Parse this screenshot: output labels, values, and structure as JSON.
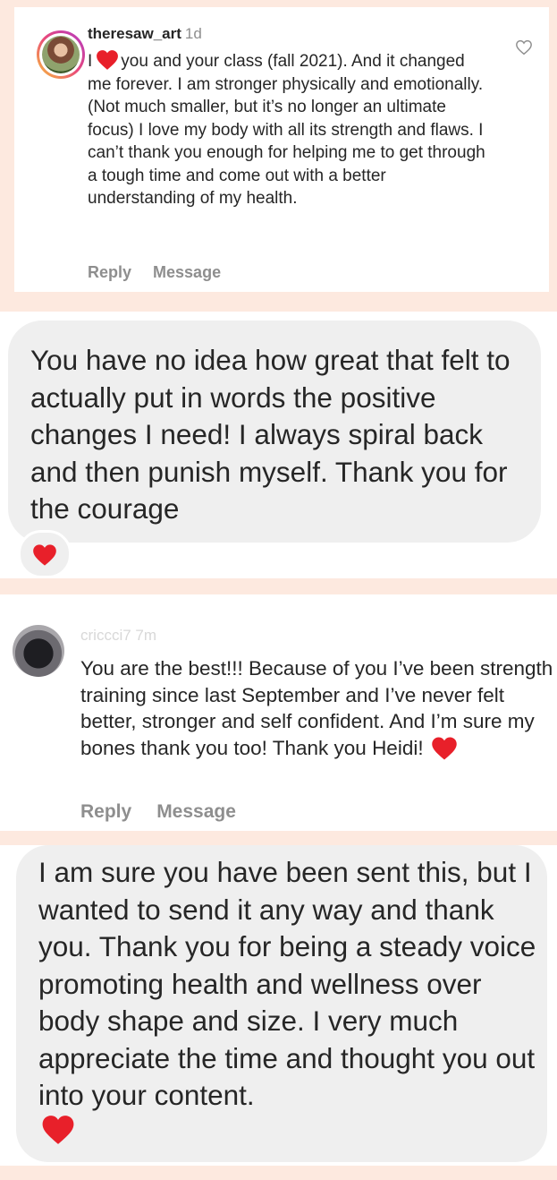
{
  "comment1": {
    "username": "theresaw_art",
    "time": "1d",
    "text_before_heart": "I",
    "text_after_heart": "you and your class (fall 2021). And it changed me forever. I am stronger physically and emotionally. (Not much smaller, but it’s no longer an ultimate focus) I love my body with all its strength and flaws. I can’t thank you enough for helping me to get through a tough time and come out with a better understanding of my health.",
    "reply_label": "Reply",
    "message_label": "Message",
    "like_icon": "heart-outline-icon"
  },
  "message1": {
    "text": "You have no idea how great that felt to actually put in words the positive changes I need! I always spiral back and then punish myself. Thank you for the courage",
    "reaction_icon": "red-heart-icon"
  },
  "comment2": {
    "username": "criccci7 7m",
    "text": "You are the best!!! Because of you I’ve been strength training since last September and I’ve never felt better, stronger and self confident.  And I’m sure my bones thank you too!  Thank you Heidi!",
    "reply_label": "Reply",
    "message_label": "Message"
  },
  "message2": {
    "text": "I am sure you have been sent this, but I wanted to send it any way and thank you. Thank you for being a steady voice promoting health and wellness over body shape and size. I very much appreciate the time and thought you out into your content."
  },
  "colors": {
    "background": "#fde9df",
    "bubble": "#efefef",
    "heart": "#e8202a",
    "text": "#262626",
    "muted": "#8e8e8e"
  }
}
